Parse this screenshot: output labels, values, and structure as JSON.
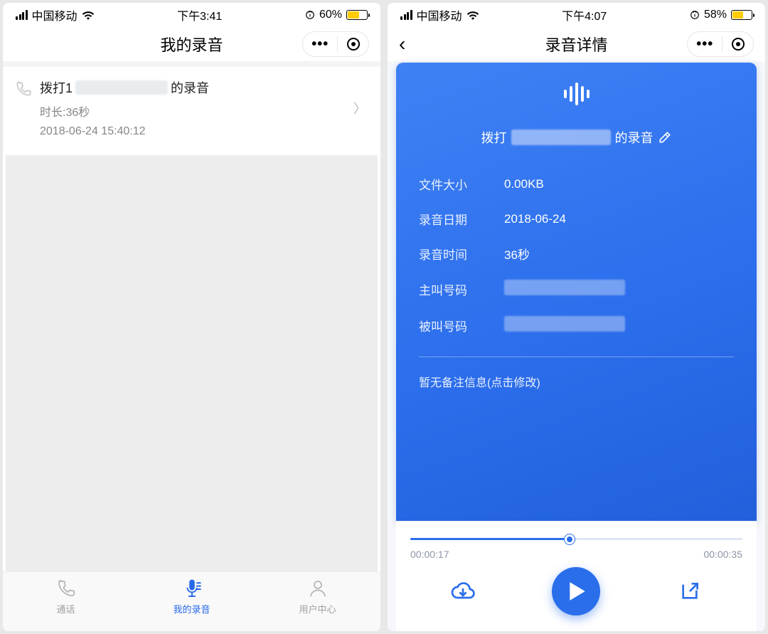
{
  "left": {
    "status": {
      "carrier": "中国移动",
      "time": "下午3:41",
      "battery_pct": "60%",
      "battery_level": 60
    },
    "title": "我的录音",
    "item": {
      "title_prefix": "拨打1",
      "title_suffix": "的录音",
      "duration_line": "时长:36秒",
      "timestamp": "2018-06-24 15:40:12"
    },
    "tabs": {
      "call": "通话",
      "recordings": "我的录音",
      "user": "用户中心"
    }
  },
  "right": {
    "status": {
      "carrier": "中国移动",
      "time": "下午4:07",
      "battery_pct": "58%",
      "battery_level": 58
    },
    "title": "录音详情",
    "card_title_prefix": "拨打",
    "card_title_suffix": "的录音",
    "info": {
      "size_label": "文件大小",
      "size_value": "0.00KB",
      "date_label": "录音日期",
      "date_value": "2018-06-24",
      "time_label": "录音时间",
      "time_value": "36秒",
      "caller_label": "主叫号码",
      "callee_label": "被叫号码"
    },
    "note_placeholder": "暂无备注信息(点击修改)",
    "player": {
      "elapsed": "00:00:17",
      "total": "00:00:35",
      "progress_pct": 48
    }
  }
}
